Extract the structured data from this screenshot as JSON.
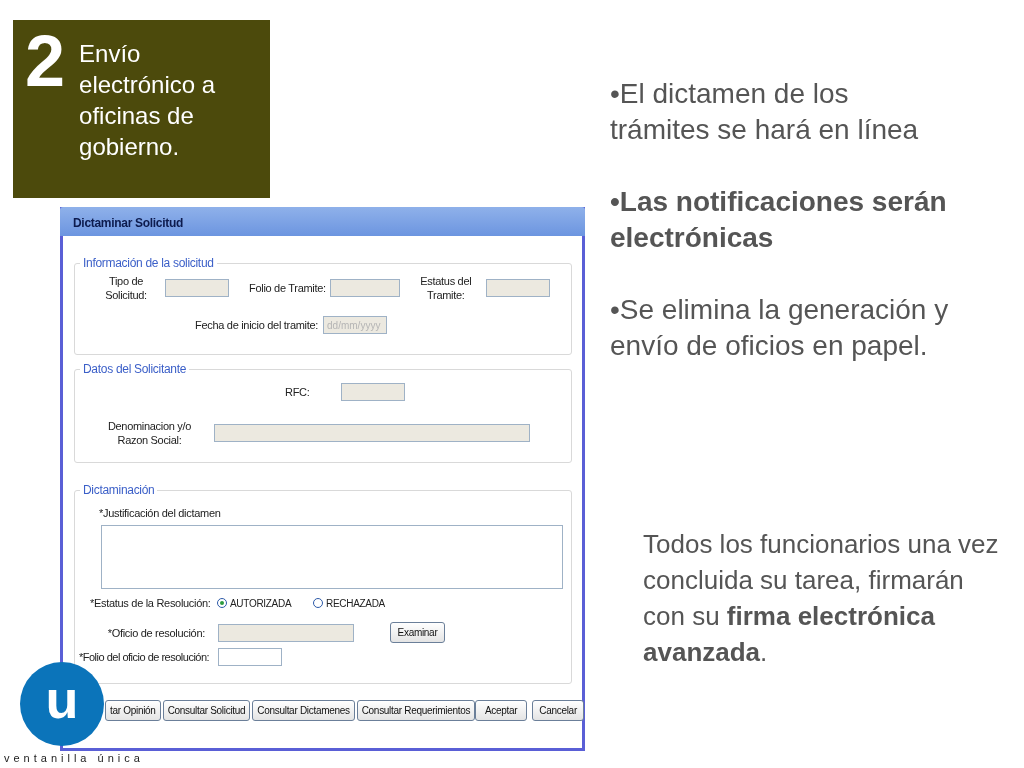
{
  "slide": {
    "number": "2",
    "heading": "Envío electrónico a oficinas de gobierno."
  },
  "window": {
    "title": "Dictaminar Solicitud",
    "request_info": {
      "legend": "Información de la solicitud",
      "fields": [
        {
          "label": "Tipo de Solicitud:",
          "disabled": true
        },
        {
          "label": "Folio de Tramite:",
          "disabled": true
        },
        {
          "label": "Estatus del Tramite:",
          "disabled": true
        },
        {
          "label": "Fecha de inicio del tramite:",
          "placeholder": "dd/mm/yyyy",
          "disabled": true
        }
      ]
    },
    "applicant": {
      "legend": "Datos del Solicitante",
      "fields": [
        {
          "label": "RFC:",
          "disabled": true
        },
        {
          "label": "Denominacion y/o Razon Social:",
          "disabled": true
        }
      ]
    },
    "ruling": {
      "legend": "Dictaminación",
      "justification_label": "*Justificación del dictamen",
      "status_label": "*Estatus de la Resolución:",
      "status_options": [
        {
          "label": "AUTORIZADA",
          "selected": true
        },
        {
          "label": "RECHAZADA",
          "selected": false
        }
      ],
      "document_label": "*Oficio de resolución:",
      "document_disabled": true,
      "browse_button": "Examinar",
      "folio_label": "*Folio del oficio de resolución:",
      "folio_disabled": false
    },
    "buttons": [
      "tar Opinión",
      "Consultar Solicitud",
      "Consultar Dictamenes",
      "Consultar Requerimientos"
    ],
    "actions": [
      "Aceptar",
      "Cancelar"
    ]
  },
  "bullets": [
    {
      "text": "•El dictamen de los trámites se hará en línea",
      "bold": false
    },
    {
      "text": "•Las notificaciones serán electrónicas",
      "bold": true
    },
    {
      "text": "•Se elimina la generación y envío de oficios en papel.",
      "bold": false
    }
  ],
  "note": "Todos los funcionarios una vez concluida su tarea, firmarán con su **firma electrónica avanzada**.",
  "logo": {
    "letter": "u",
    "caption": "ventanilla única"
  }
}
